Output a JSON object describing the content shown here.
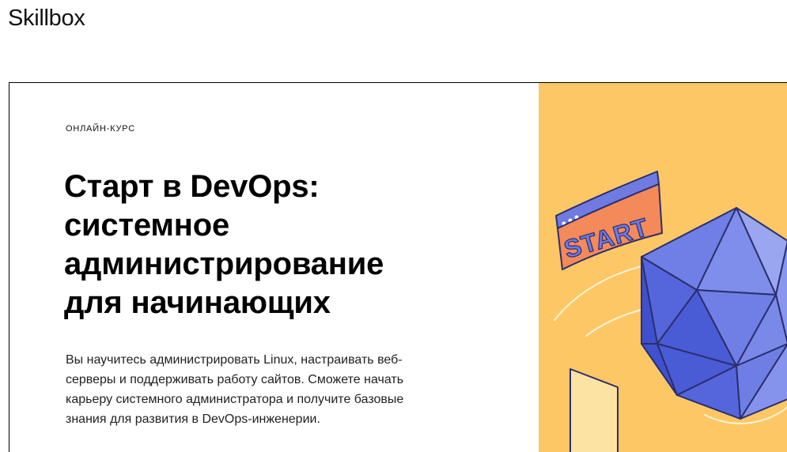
{
  "header": {
    "logo_text": "Skillbox"
  },
  "hero": {
    "eyebrow": "ОНЛАЙН-КУРС",
    "title_lines": [
      "Старт в DevOps:",
      "системное",
      "администрирование",
      "для начинающих"
    ],
    "description_lines": [
      "Вы научитесь администрировать Linux, настраивать веб-",
      "серверы и поддерживать работу сайтов. Сможете начать",
      "карьеру системного администратора и получите базовые",
      "знания для развития в DevOps-инженерии."
    ]
  },
  "illustration": {
    "banner_text": "START",
    "colors": {
      "background": "#fdc766",
      "banner": "#f4895a",
      "banner_bar": "#6f7be0",
      "polyhedron_dark": "#4a5bd6",
      "polyhedron_mid": "#6f7fe6",
      "polyhedron_light": "#9aa6f0",
      "outline": "#2b2f6e",
      "paper": "#fde3a3"
    }
  }
}
